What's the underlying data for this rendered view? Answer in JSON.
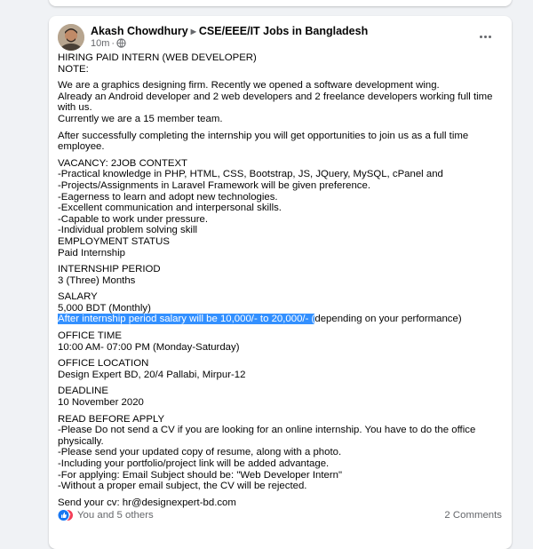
{
  "post": {
    "author": "Akash Chowdhury",
    "group": "CSE/EEE/IT Jobs in Bangladesh",
    "time": "10m",
    "paragraphs": [
      [
        "HIRING PAID INTERN (WEB DEVELOPER)",
        "NOTE:"
      ],
      [
        "We are a graphics designing firm. Recently we opened a software development wing.",
        "Already an Android developer and 2 web developers and 2 freelance developers working full time",
        "with us.",
        "Currently we are a 15 member team."
      ],
      [
        "After successfully completing the internship you will get opportunities to join us as a full time",
        "employee."
      ],
      [
        "VACANCY: 2JOB CONTEXT",
        "-Practical knowledge in PHP, HTML, CSS, Bootstrap, JS, JQuery, MySQL, cPanel and",
        "-Projects/Assignments in Laravel Framework will be given preference.",
        "-Eagerness to learn and adopt new technologies.",
        "-Excellent communication and interpersonal skills.",
        "-Capable to work under pressure.",
        "-Individual problem solving skill",
        "EMPLOYMENT STATUS",
        "Paid Internship"
      ],
      [
        "INTERNSHIP PERIOD",
        "3 (Three) Months"
      ],
      [
        "SALARY",
        "5,000 BDT (Monthly)"
      ]
    ],
    "salary_highlight": "After internship period salary will be 10,000/- to 20,000/- (",
    "salary_rest": "depending on your performance)",
    "paragraphs2": [
      [
        "OFFICE TIME",
        "10:00 AM- 07:00 PM (Monday-Saturday)"
      ],
      [
        "OFFICE LOCATION",
        "Design Expert BD, 20/4 Pallabi, Mirpur-12"
      ],
      [
        "DEADLINE",
        "10 November 2020"
      ],
      [
        "READ BEFORE APPLY",
        "-Please Do not send a CV if you are looking for an online internship. You have to do the office",
        "physically.",
        "-Please send your updated copy of resume, along with a photo.",
        "-Including your portfolio/project link will be added advantage.",
        "-For applying: Email Subject should be: \"Web Developer Intern\"",
        "-Without a proper email subject, the CV will be rejected."
      ],
      [
        "Send your cv: hr@designexpert-bd.com"
      ]
    ],
    "reactions_text": "You and 5 others",
    "comments_text": "2 Comments"
  },
  "colors": {
    "background": "#f0f2f5",
    "card": "#ffffff",
    "secondary_text": "#65676b",
    "selection": "#3390ff",
    "like_blue": "#1877f2",
    "love_red": "#f33e58"
  },
  "icons": [
    "globe-icon",
    "more-options-icon",
    "like-reaction-icon",
    "love-reaction-icon"
  ]
}
